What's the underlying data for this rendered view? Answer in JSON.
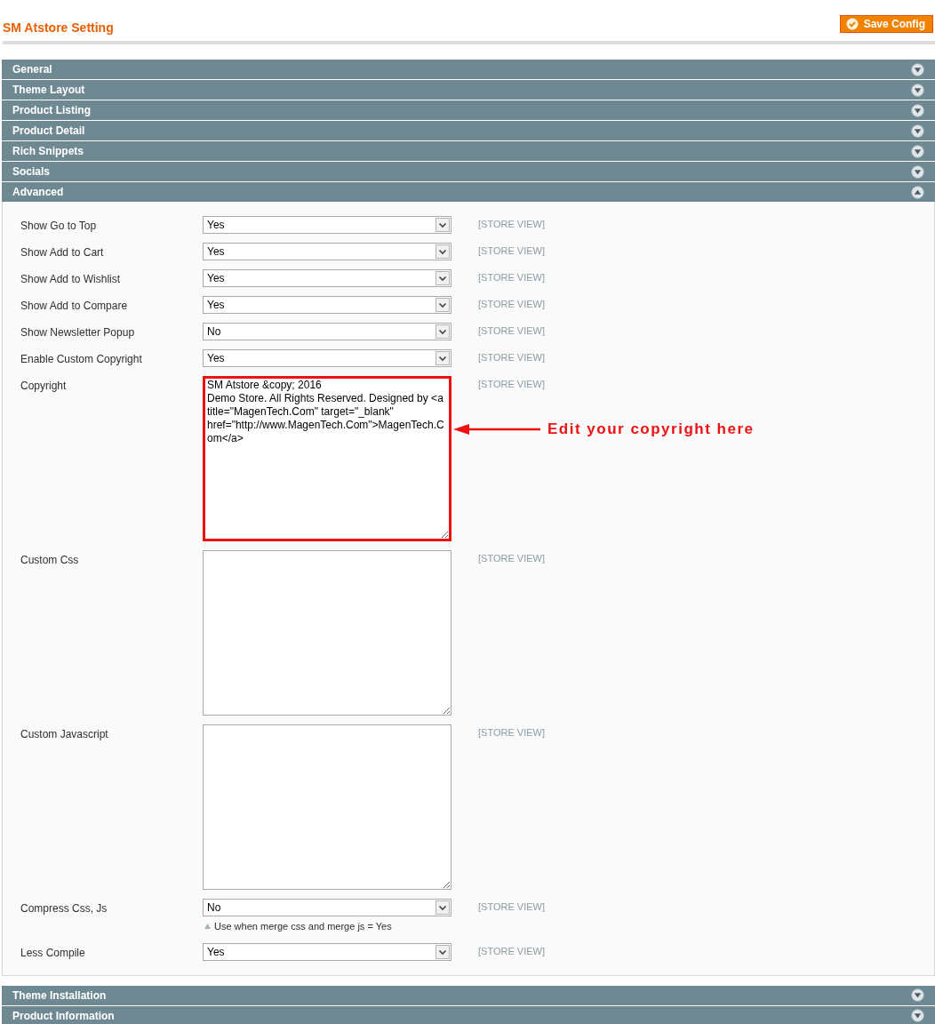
{
  "page_title": "SM Atstore Setting",
  "save_button": {
    "label": "Save Config"
  },
  "sections": [
    {
      "title": "General",
      "expanded": false
    },
    {
      "title": "Theme Layout",
      "expanded": false
    },
    {
      "title": "Product Listing",
      "expanded": false
    },
    {
      "title": "Product Detail",
      "expanded": false
    },
    {
      "title": "Rich Snippets",
      "expanded": false
    },
    {
      "title": "Socials",
      "expanded": false
    },
    {
      "title": "Advanced",
      "expanded": true,
      "fields": [
        {
          "kind": "select",
          "label": "Show Go to Top",
          "value": "Yes",
          "scope": "[STORE VIEW]"
        },
        {
          "kind": "select",
          "label": "Show Add to Cart",
          "value": "Yes",
          "scope": "[STORE VIEW]"
        },
        {
          "kind": "select",
          "label": "Show Add to Wishlist",
          "value": "Yes",
          "scope": "[STORE VIEW]"
        },
        {
          "kind": "select",
          "label": "Show Add to Compare",
          "value": "Yes",
          "scope": "[STORE VIEW]"
        },
        {
          "kind": "select",
          "label": "Show Newsletter Popup",
          "value": "No",
          "scope": "[STORE VIEW]"
        },
        {
          "kind": "select",
          "label": "Enable Custom Copyright",
          "value": "Yes",
          "scope": "[STORE VIEW]"
        },
        {
          "kind": "textarea",
          "label": "Copyright",
          "value": "SM Atstore &copy; 2016\nDemo Store. All Rights Reserved. Designed by <a title=\"MagenTech.Com\" target=\"_blank\" href=\"http://www.MagenTech.Com\">MagenTech.Com</a>",
          "scope": "[STORE VIEW]",
          "highlighted": true,
          "annotation": "Edit your copyright here"
        },
        {
          "kind": "textarea",
          "label": "Custom Css",
          "scope": "[STORE VIEW]",
          "highlighted": false
        },
        {
          "kind": "textarea",
          "label": "Custom Javascript",
          "scope": "[STORE VIEW]",
          "highlighted": false
        },
        {
          "kind": "select",
          "label": "Compress Css, Js",
          "value": "No",
          "scope": "[STORE VIEW]",
          "note": "Use when merge css and merge js = Yes"
        },
        {
          "kind": "select",
          "label": "Less Compile",
          "value": "Yes",
          "scope": "[STORE VIEW]"
        }
      ]
    },
    {
      "title": "Theme Installation",
      "expanded": false
    },
    {
      "title": "Product Information",
      "expanded": false
    }
  ]
}
